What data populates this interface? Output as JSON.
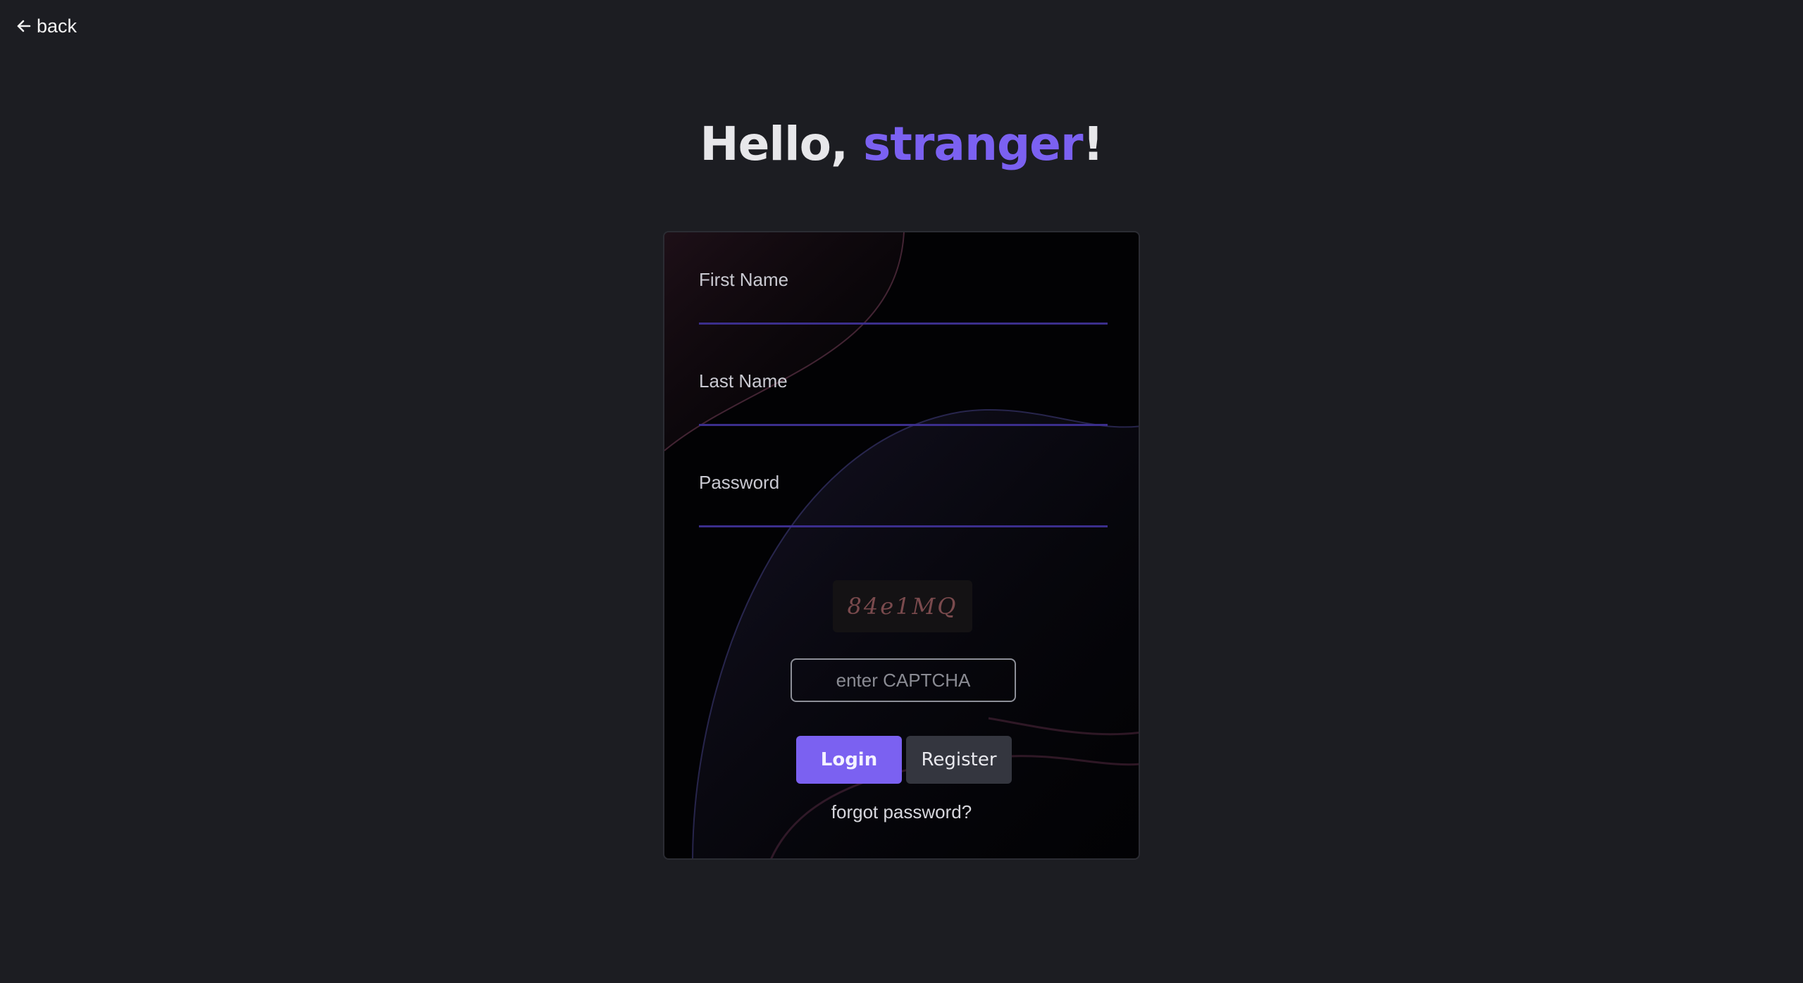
{
  "nav": {
    "back_label": "back"
  },
  "greeting": {
    "prefix": "Hello, ",
    "name": "stranger",
    "suffix": "!"
  },
  "form": {
    "first_name_label": "First Name",
    "first_name_value": "",
    "last_name_label": "Last Name",
    "last_name_value": "",
    "password_label": "Password",
    "password_value": "",
    "captcha_code": "84e1MQ",
    "captcha_placeholder": "enter CAPTCHA",
    "captcha_value": "",
    "login_label": "Login",
    "register_label": "Register",
    "forgot_label": "forgot password?"
  },
  "colors": {
    "background": "#1c1d22",
    "accent": "#7b61f1",
    "card": "#020204",
    "input_underline": "#3b2e8c",
    "secondary_button": "#34363f"
  },
  "icons": {
    "back": "arrow-left-icon"
  }
}
